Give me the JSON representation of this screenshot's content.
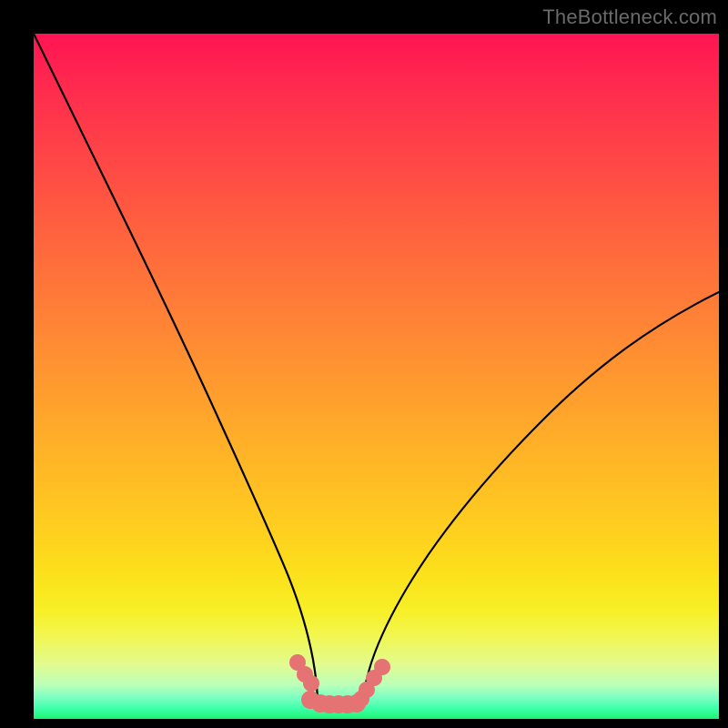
{
  "watermark": "TheBottleneck.com",
  "chart_data": {
    "type": "line",
    "title": "",
    "xlabel": "",
    "ylabel": "",
    "xlim": [
      0,
      100
    ],
    "ylim": [
      0,
      100
    ],
    "legend": false,
    "background_gradient": {
      "direction": "vertical",
      "stops": [
        {
          "pos": 0.0,
          "color": "#ff1452"
        },
        {
          "pos": 0.4,
          "color": "#ff7e37"
        },
        {
          "pos": 0.72,
          "color": "#ffce1f"
        },
        {
          "pos": 0.88,
          "color": "#f1f651"
        },
        {
          "pos": 1.0,
          "color": "#1cf573"
        }
      ]
    },
    "series": [
      {
        "name": "left-curve",
        "color": "#000000",
        "type": "line",
        "x": [
          0.0,
          3.0,
          6.0,
          9.0,
          12.0,
          15.0,
          18.0,
          21.0,
          24.0,
          26.5,
          29.0,
          31.0,
          33.0,
          34.5,
          36.0,
          37.2,
          38.3,
          39.0,
          39.8,
          40.6,
          41.4
        ],
        "y": [
          100.0,
          90.0,
          80.5,
          71.5,
          63.0,
          55.0,
          47.5,
          40.5,
          34.0,
          28.5,
          23.5,
          19.3,
          15.6,
          12.9,
          10.5,
          8.6,
          6.9,
          5.7,
          4.5,
          3.4,
          2.3
        ]
      },
      {
        "name": "right-curve",
        "color": "#000000",
        "type": "line",
        "x": [
          47.9,
          49.0,
          50.3,
          51.8,
          53.5,
          55.5,
          58.0,
          61.0,
          64.5,
          68.5,
          73.0,
          78.0,
          83.5,
          89.5,
          96.0,
          100.0
        ],
        "y": [
          2.3,
          3.6,
          5.2,
          7.0,
          9.2,
          11.8,
          15.0,
          18.8,
          23.0,
          27.8,
          33.0,
          38.7,
          44.8,
          51.3,
          58.2,
          62.3
        ]
      },
      {
        "name": "valley-markers",
        "color": "#e57373",
        "type": "scatter",
        "x": [
          38.5,
          39.6,
          40.5,
          40.4,
          41.8,
          43.1,
          44.4,
          45.8,
          47.2,
          47.8,
          48.6,
          49.7,
          50.8
        ],
        "y": [
          8.2,
          6.5,
          5.2,
          2.8,
          2.2,
          2.1,
          2.1,
          2.1,
          2.2,
          2.9,
          4.3,
          6.0,
          7.5
        ],
        "marker_radius": 1.3
      }
    ]
  }
}
